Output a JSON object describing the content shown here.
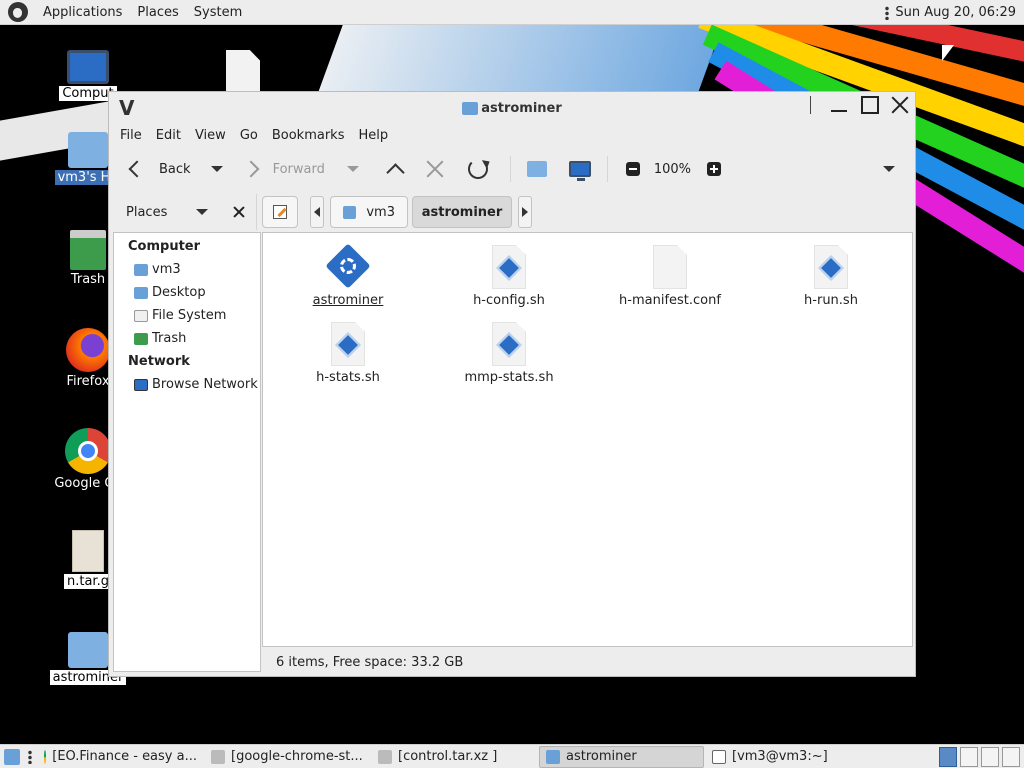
{
  "top_panel": {
    "menu": [
      "Applications",
      "Places",
      "System"
    ],
    "clock": "Sun Aug 20, 06:29"
  },
  "desktop": {
    "icons": [
      {
        "label": "Comput",
        "icon": "computer-icon"
      },
      {
        "label": "vm3's Ho",
        "icon": "home-folder-icon",
        "selected": true
      },
      {
        "label": "Trash",
        "icon": "trash-icon"
      },
      {
        "label": "Firefox",
        "icon": "firefox-icon"
      },
      {
        "label": "Google Ch",
        "icon": "chrome-icon"
      },
      {
        "label": "n.tar.g",
        "icon": "archive-icon"
      },
      {
        "label": "astrominer",
        "icon": "folder-icon"
      }
    ]
  },
  "window": {
    "title": "astrominer",
    "menubar": [
      "File",
      "Edit",
      "View",
      "Go",
      "Bookmarks",
      "Help"
    ],
    "toolbar": {
      "back": "Back",
      "forward": "Forward",
      "zoom": "100%"
    },
    "location": {
      "places_label": "Places",
      "crumbs": [
        "vm3",
        "astrominer"
      ]
    },
    "sidebar": {
      "computer_heading": "Computer",
      "computer_items": [
        "vm3",
        "Desktop",
        "File System",
        "Trash"
      ],
      "network_heading": "Network",
      "network_items": [
        "Browse Network"
      ]
    },
    "files": [
      {
        "name": "astrominer",
        "type": "executable"
      },
      {
        "name": "h-config.sh",
        "type": "script"
      },
      {
        "name": "h-manifest.conf",
        "type": "text"
      },
      {
        "name": "h-run.sh",
        "type": "script"
      },
      {
        "name": "h-stats.sh",
        "type": "script"
      },
      {
        "name": "mmp-stats.sh",
        "type": "script"
      }
    ],
    "status": "6 items, Free space: 33.2 GB"
  },
  "taskbar": {
    "tasks": [
      {
        "label": "[EO.Finance - easy a...",
        "icon": "chrome-icon"
      },
      {
        "label": "[google-chrome-st...",
        "icon": "archive-manager-icon"
      },
      {
        "label": "[control.tar.xz ]",
        "icon": "archive-manager-icon"
      },
      {
        "label": "astrominer",
        "icon": "folder-icon",
        "active": true
      },
      {
        "label": "[vm3@vm3:~]",
        "icon": "terminal-icon"
      }
    ]
  }
}
